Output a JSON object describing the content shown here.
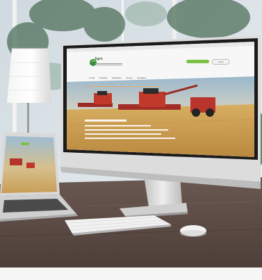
{
  "photo": {
    "description_labels": [
      "office desk",
      "desktop monitor",
      "laptop",
      "keyboard",
      "mouse",
      "table lamp",
      "window"
    ],
    "colors": {
      "desk": "#5a4a44",
      "monitor_frame": "#1b1b1b",
      "monitor_stand": "#d9d9d9",
      "keyboard": "#f1f1f1",
      "field": "#d2aa63",
      "sky": "#dfe7ec"
    }
  },
  "website": {
    "logo_text": "Agro",
    "search_label": "Поиск",
    "nav_items": [
      "О нас",
      "Техника",
      "Хранение",
      "Услуги",
      "Контакты"
    ]
  }
}
